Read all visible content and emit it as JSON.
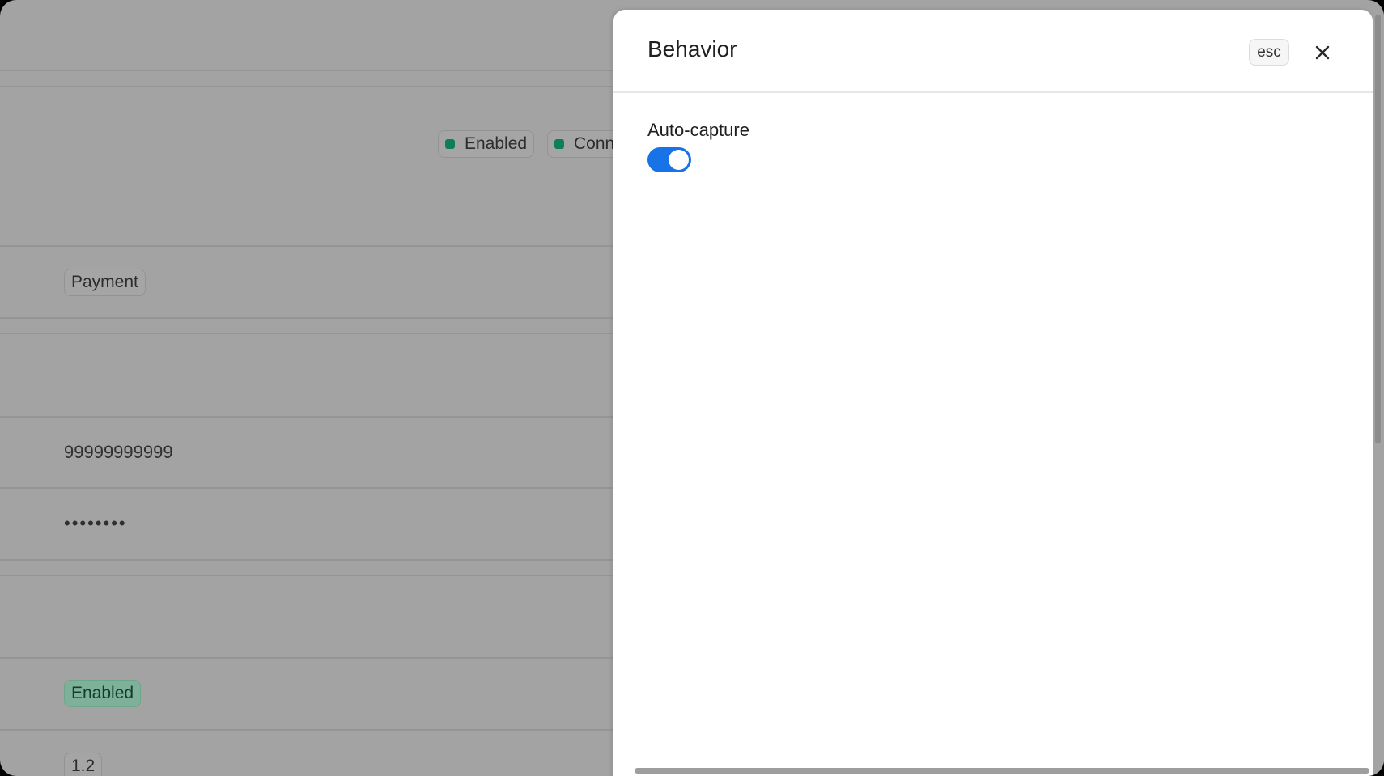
{
  "background": {
    "status_badges": [
      {
        "label": "Enabled"
      },
      {
        "label": "Conn"
      }
    ],
    "type_tag": "Payment",
    "merchant_id": "99999999999",
    "masked_secret": "••••••••",
    "state_tag": "Enabled",
    "version_tag": "1.2"
  },
  "drawer": {
    "title": "Behavior",
    "esc_hint": "esc",
    "close_icon": "close-icon",
    "fields": [
      {
        "label": "Auto-capture",
        "enabled": true
      }
    ]
  },
  "colors": {
    "toggle_on": "#1773e6",
    "status_green": "#0e7f55",
    "overlay": "#a3a3a3"
  }
}
